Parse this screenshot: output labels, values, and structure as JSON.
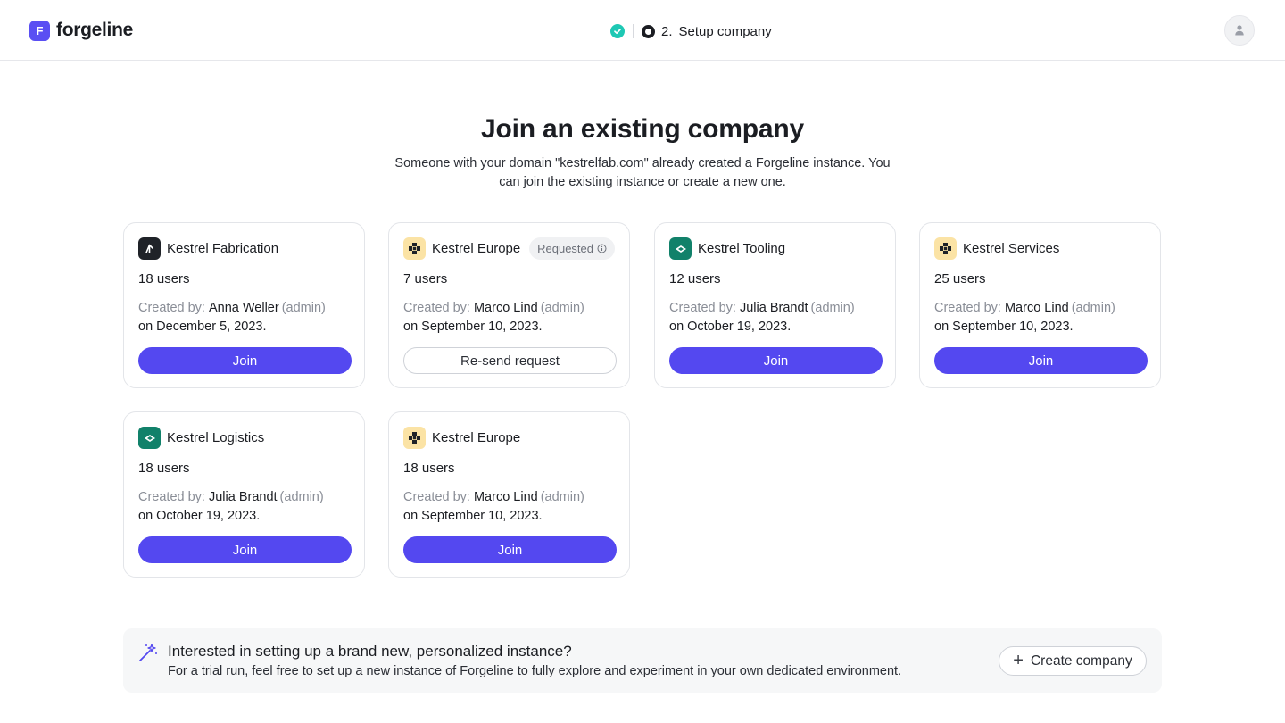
{
  "app": {
    "logo_letter": "F",
    "name": "forgeline"
  },
  "stepper": {
    "current_number": "2.",
    "current_label": "Setup company"
  },
  "hero": {
    "title": "Join an existing company",
    "subtitle": "Someone with your domain \"kestrelfab.com\" already created a Forgeline instance. You can join the existing instance or create a new one."
  },
  "companies": [
    {
      "name": "Kestrel Fabrication",
      "icon": "kestrel-dark-icon",
      "users": "18 users",
      "created_prefix": "Created by:",
      "creator": "Anna Weller",
      "role": "(admin)",
      "date": "on December 5, 2023.",
      "action": "Join"
    },
    {
      "name": "Kestrel Europe",
      "icon": "kestrel-checker-icon",
      "badge": "Requested",
      "users": "7 users",
      "created_prefix": "Created by:",
      "creator": "Marco Lind",
      "role": "(admin)",
      "date": "on September 10, 2023.",
      "action": "Re-send request"
    },
    {
      "name": "Kestrel Tooling",
      "icon": "kestrel-teal-icon",
      "users": "12 users",
      "created_prefix": "Created by:",
      "creator": "Julia Brandt",
      "role": "(admin)",
      "date": "on October 19, 2023.",
      "action": "Join"
    },
    {
      "name": "Kestrel Services",
      "icon": "kestrel-checker-icon",
      "users": "25 users",
      "created_prefix": "Created by:",
      "creator": "Marco Lind",
      "role": "(admin)",
      "date": "on September 10, 2023.",
      "action": "Join"
    },
    {
      "name": "Kestrel Logistics",
      "icon": "kestrel-teal-icon",
      "users": "18 users",
      "created_prefix": "Created by:",
      "creator": "Julia Brandt",
      "role": "(admin)",
      "date": "on October 19, 2023.",
      "action": "Join"
    },
    {
      "name": "Kestrel Europe",
      "icon": "kestrel-checker-icon",
      "users": "18 users",
      "created_prefix": "Created by:",
      "creator": "Marco Lind",
      "role": "(admin)",
      "date": "on September 10, 2023.",
      "action": "Join"
    }
  ],
  "banner": {
    "title": "Interested in setting up a brand new, personalized instance?",
    "text": "For a trial run, feel free to set up a new instance of Forgeline to fully explore and experiment in your own dedicated environment.",
    "button_label": "Create company"
  },
  "colors": {
    "accent": "#5448f0",
    "success": "#1ec8b4",
    "teal": "#11816a",
    "yellow": "#fbe3a5"
  }
}
